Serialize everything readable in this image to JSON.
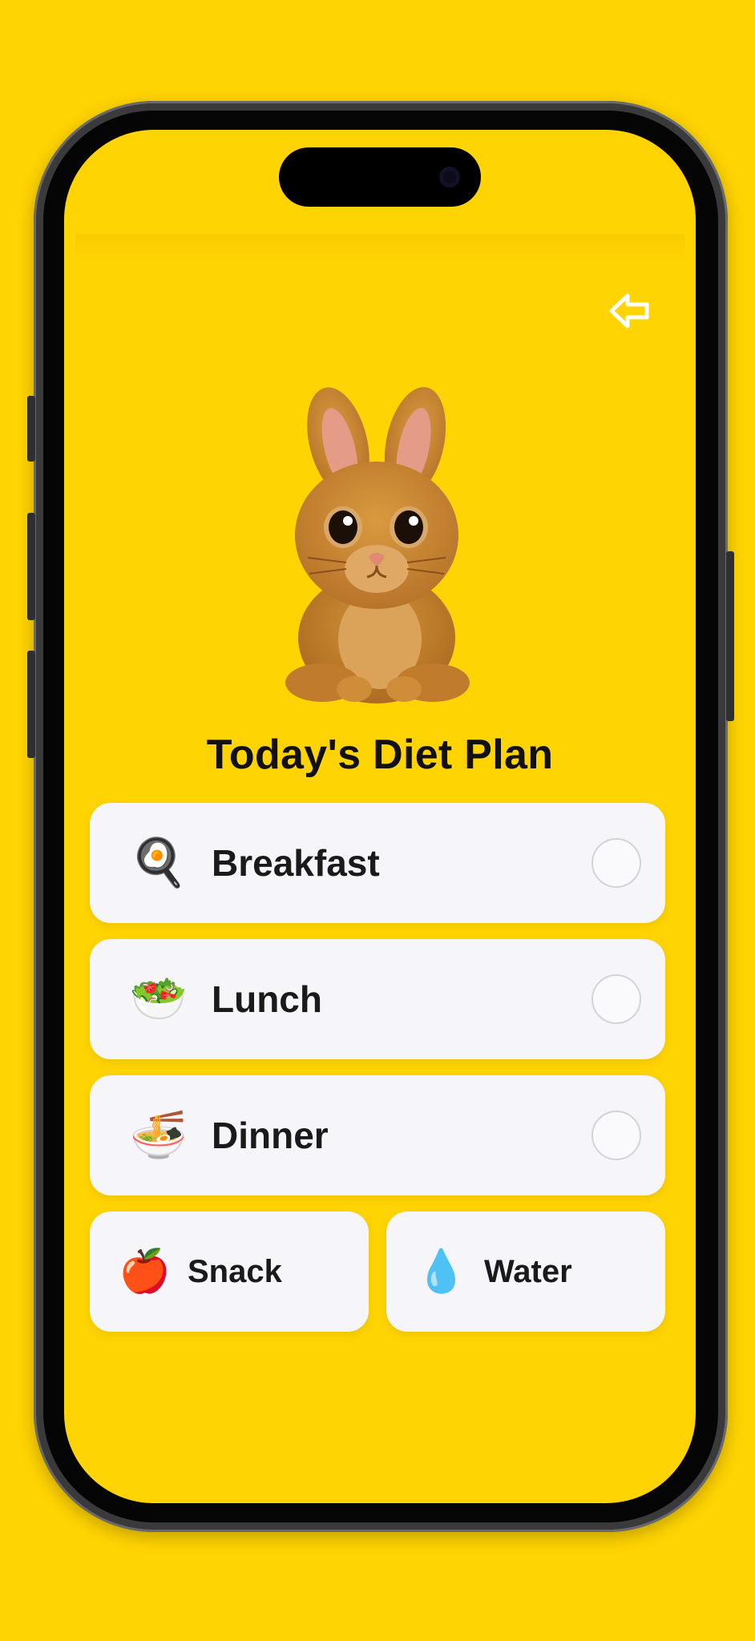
{
  "header": {
    "title": "Today's Diet Plan"
  },
  "meals": [
    {
      "label": "Breakfast",
      "icon": "🍳",
      "checked": false
    },
    {
      "label": "Lunch",
      "icon": "🥗",
      "checked": false
    },
    {
      "label": "Dinner",
      "icon": "🍜",
      "checked": false
    }
  ],
  "extras": [
    {
      "label": "Snack",
      "icon": "🍎"
    },
    {
      "label": "Water",
      "icon": "💧"
    }
  ],
  "colors": {
    "background": "#FFD402",
    "card": "#F6F6FA",
    "text": "#111111"
  }
}
